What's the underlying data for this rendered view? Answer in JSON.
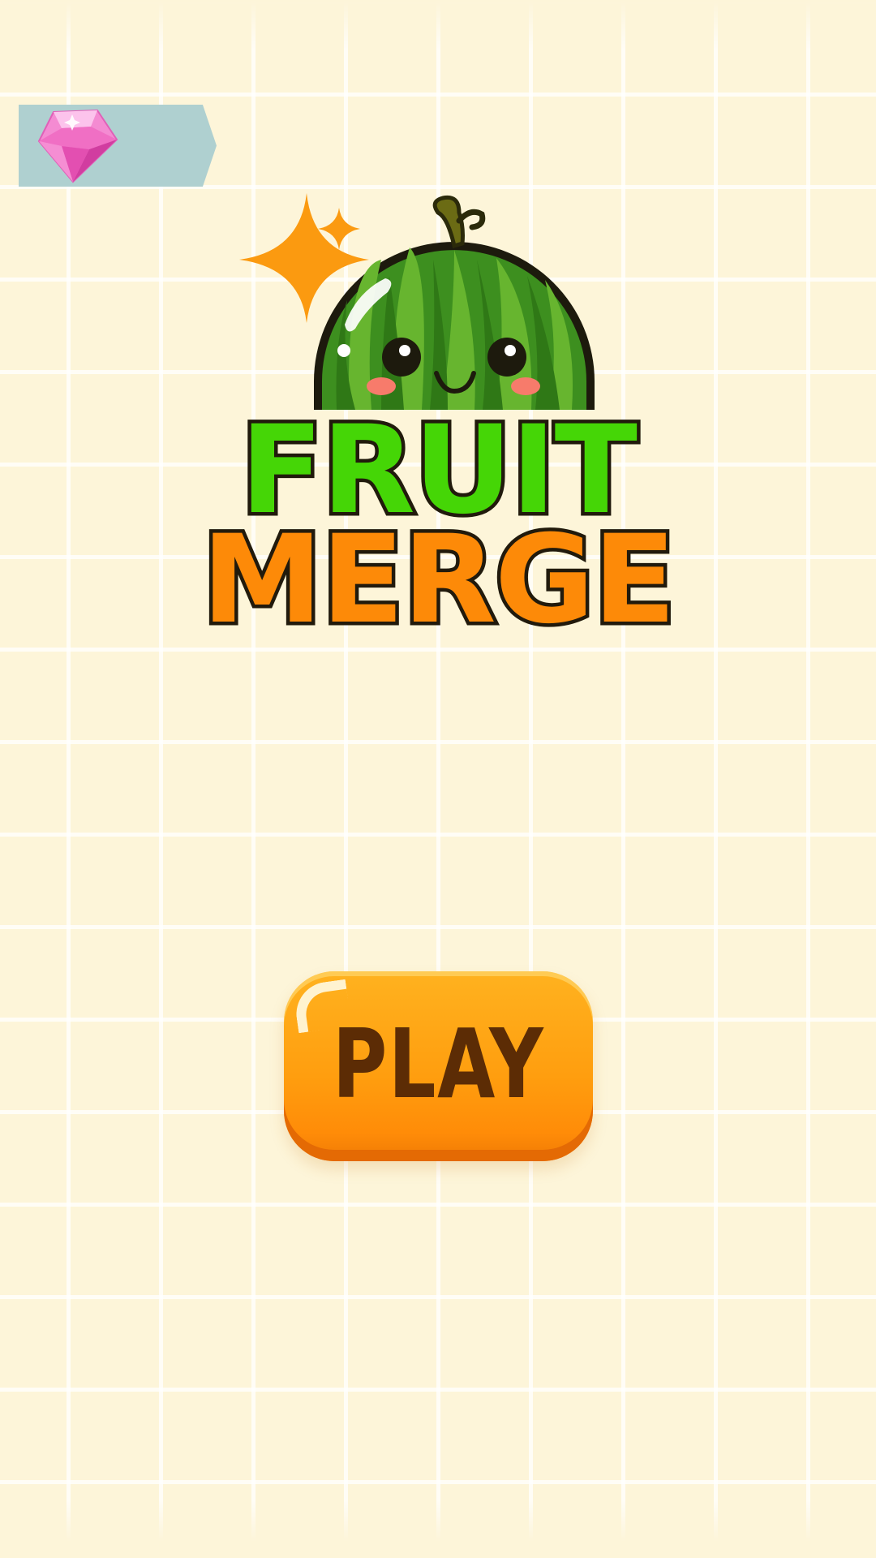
{
  "game": {
    "title_line1": "FRUIT",
    "title_line2": "MERGE",
    "mascot_icon": "watermelon-icon",
    "sparkle_icon": "sparkle-icon"
  },
  "currency": {
    "icon": "pink-gem-icon",
    "count": ""
  },
  "play_button": {
    "label": "PLAY"
  },
  "colors": {
    "background": "#fdf5d9",
    "title_green": "#45d606",
    "title_orange": "#fd8a08",
    "title_outline": "#211a0c",
    "button_orange": "#ff9e0f",
    "button_text": "#5c2c05",
    "gem_banner": "#afd0d0",
    "gem_pink": "#f06fc4"
  }
}
